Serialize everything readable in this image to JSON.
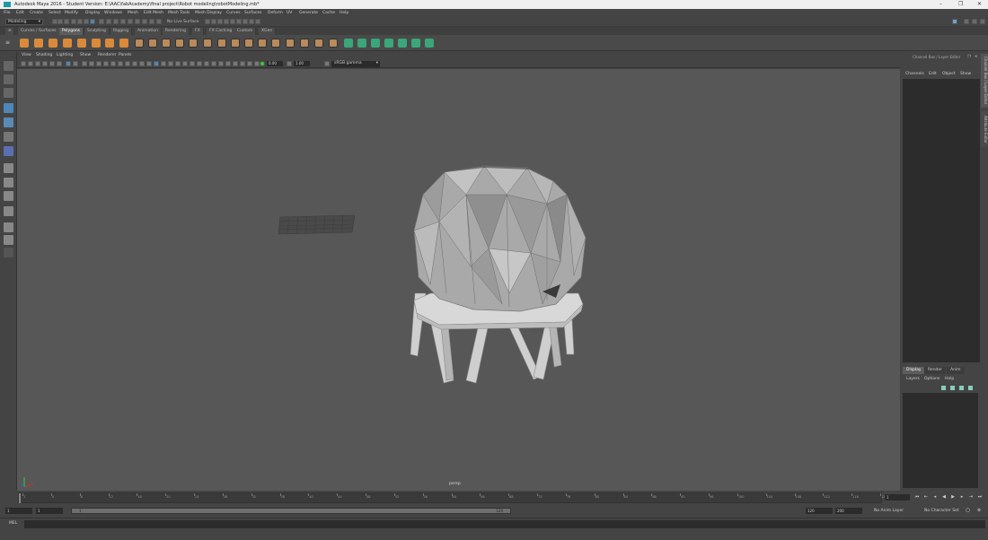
{
  "window": {
    "title": "Autodesk Maya 2016 - Student Version: E:\\AAC\\fabAcademy\\final project\\Robot modeling\\robotModeling.mb*"
  },
  "menubar": [
    "File",
    "Edit",
    "Create",
    "Select",
    "Modify",
    "Display",
    "Windows",
    "Mesh",
    "Edit Mesh",
    "Mesh Tools",
    "Mesh Display",
    "Curves",
    "Surfaces",
    "Deform",
    "UV",
    "Generate",
    "Cache",
    "Help"
  ],
  "statusline": {
    "mode": "Modeling",
    "live_surface": "No Live Surface"
  },
  "shelf_tabs": [
    "Curves / Surfaces",
    "Polygons",
    "Sculpting",
    "Rigging",
    "Animation",
    "Rendering",
    "FX",
    "FX Caching",
    "Custom",
    "XGen"
  ],
  "shelf_active": "Polygons",
  "panel_menu": [
    "View",
    "Shading",
    "Lighting",
    "Show",
    "Renderer",
    "Panels"
  ],
  "panel_toolbar": {
    "exposure": "0.00",
    "gamma_val": "1.00",
    "color_space": "sRGB gamma"
  },
  "viewport": {
    "camera": "persp"
  },
  "right_panel": {
    "header": "Channel Box / Layer Editor",
    "cb_menu": [
      "Channels",
      "Edit",
      "Object",
      "Show"
    ],
    "vtabs": [
      "Channel Box / Layer Editor",
      "Attribute Editor"
    ],
    "le_tabs": [
      "Display",
      "Render",
      "Anim"
    ],
    "le_active": "Display",
    "le_menu": [
      "Layers",
      "Options",
      "Help"
    ]
  },
  "timeline": {
    "ticks": [
      "1",
      "4",
      "8",
      "12",
      "16",
      "20",
      "24",
      "28",
      "32",
      "36",
      "40",
      "44",
      "48",
      "52",
      "56",
      "60",
      "64",
      "68",
      "72",
      "76",
      "80",
      "84",
      "88",
      "92",
      "96",
      "100",
      "104",
      "108",
      "112",
      "116",
      "120"
    ],
    "current_frame": "1"
  },
  "range": {
    "start": "1",
    "playback_start": "1",
    "slider_low": "1",
    "slider_high": "120",
    "playback_end": "120",
    "end": "200",
    "anim_layer": "No Anim Layer",
    "char_set": "No Character Set"
  },
  "cmdline": {
    "label": "MEL"
  },
  "colors": {
    "orange_icon": "#d98a3a",
    "green_icon": "#3aa67a",
    "blue_active": "#4f86b5"
  }
}
